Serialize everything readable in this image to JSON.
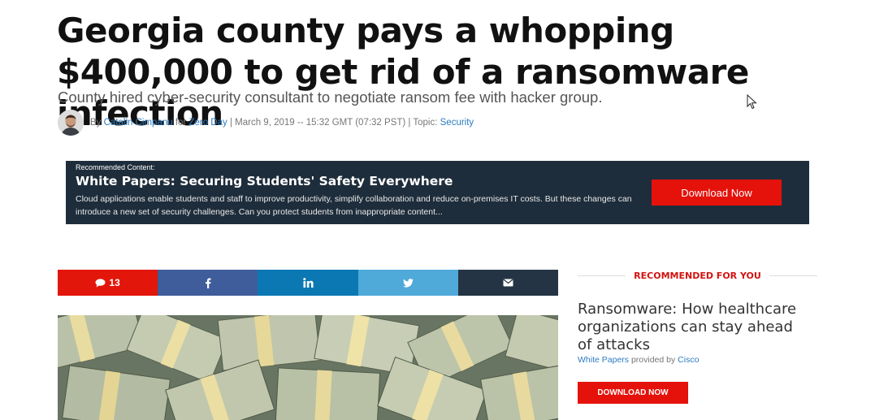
{
  "article": {
    "headline": "Georgia county pays a whopping $400,000 to get rid of a ransomware infection",
    "subheadline": "County hired cyber-security consultant to negotiate ransom fee with hacker group.",
    "byline": {
      "prefix": "By",
      "author": "Catalin Cimpanu",
      "for_text": "for",
      "publication": "Zero Day",
      "date": "| March 9, 2019 -- 15:32 GMT (07:32 PST) | Topic:",
      "topic": "Security"
    }
  },
  "promo": {
    "label": "Recommended Content:",
    "title": "White Papers: Securing Students' Safety Everywhere",
    "description": "Cloud applications enable students and staff to improve productivity, simplify collaboration and reduce on-premises IT costs. But these changes can introduce a new set of security challenges. Can you protect students from inappropriate content...",
    "button": "Download Now"
  },
  "share": {
    "comment_count": "13",
    "icons": [
      "comment-icon",
      "facebook-icon",
      "linkedin-icon",
      "twitter-icon",
      "email-icon"
    ],
    "colors": {
      "comments": "#e3160b",
      "facebook": "#3e5d9a",
      "linkedin": "#0b78b4",
      "twitter": "#4fa9d9",
      "email": "#243444"
    }
  },
  "sidebar": {
    "heading": "RECOMMENDED FOR YOU",
    "title": "Ransomware: How healthcare organizations can stay ahead of attacks",
    "type": "White Papers",
    "provided_by": "provided by",
    "sponsor": "Cisco",
    "button": "DOWNLOAD NOW"
  },
  "colors": {
    "accent": "#e4120b",
    "link": "#2d7cc1",
    "promo_bg": "#1e2d3b"
  }
}
